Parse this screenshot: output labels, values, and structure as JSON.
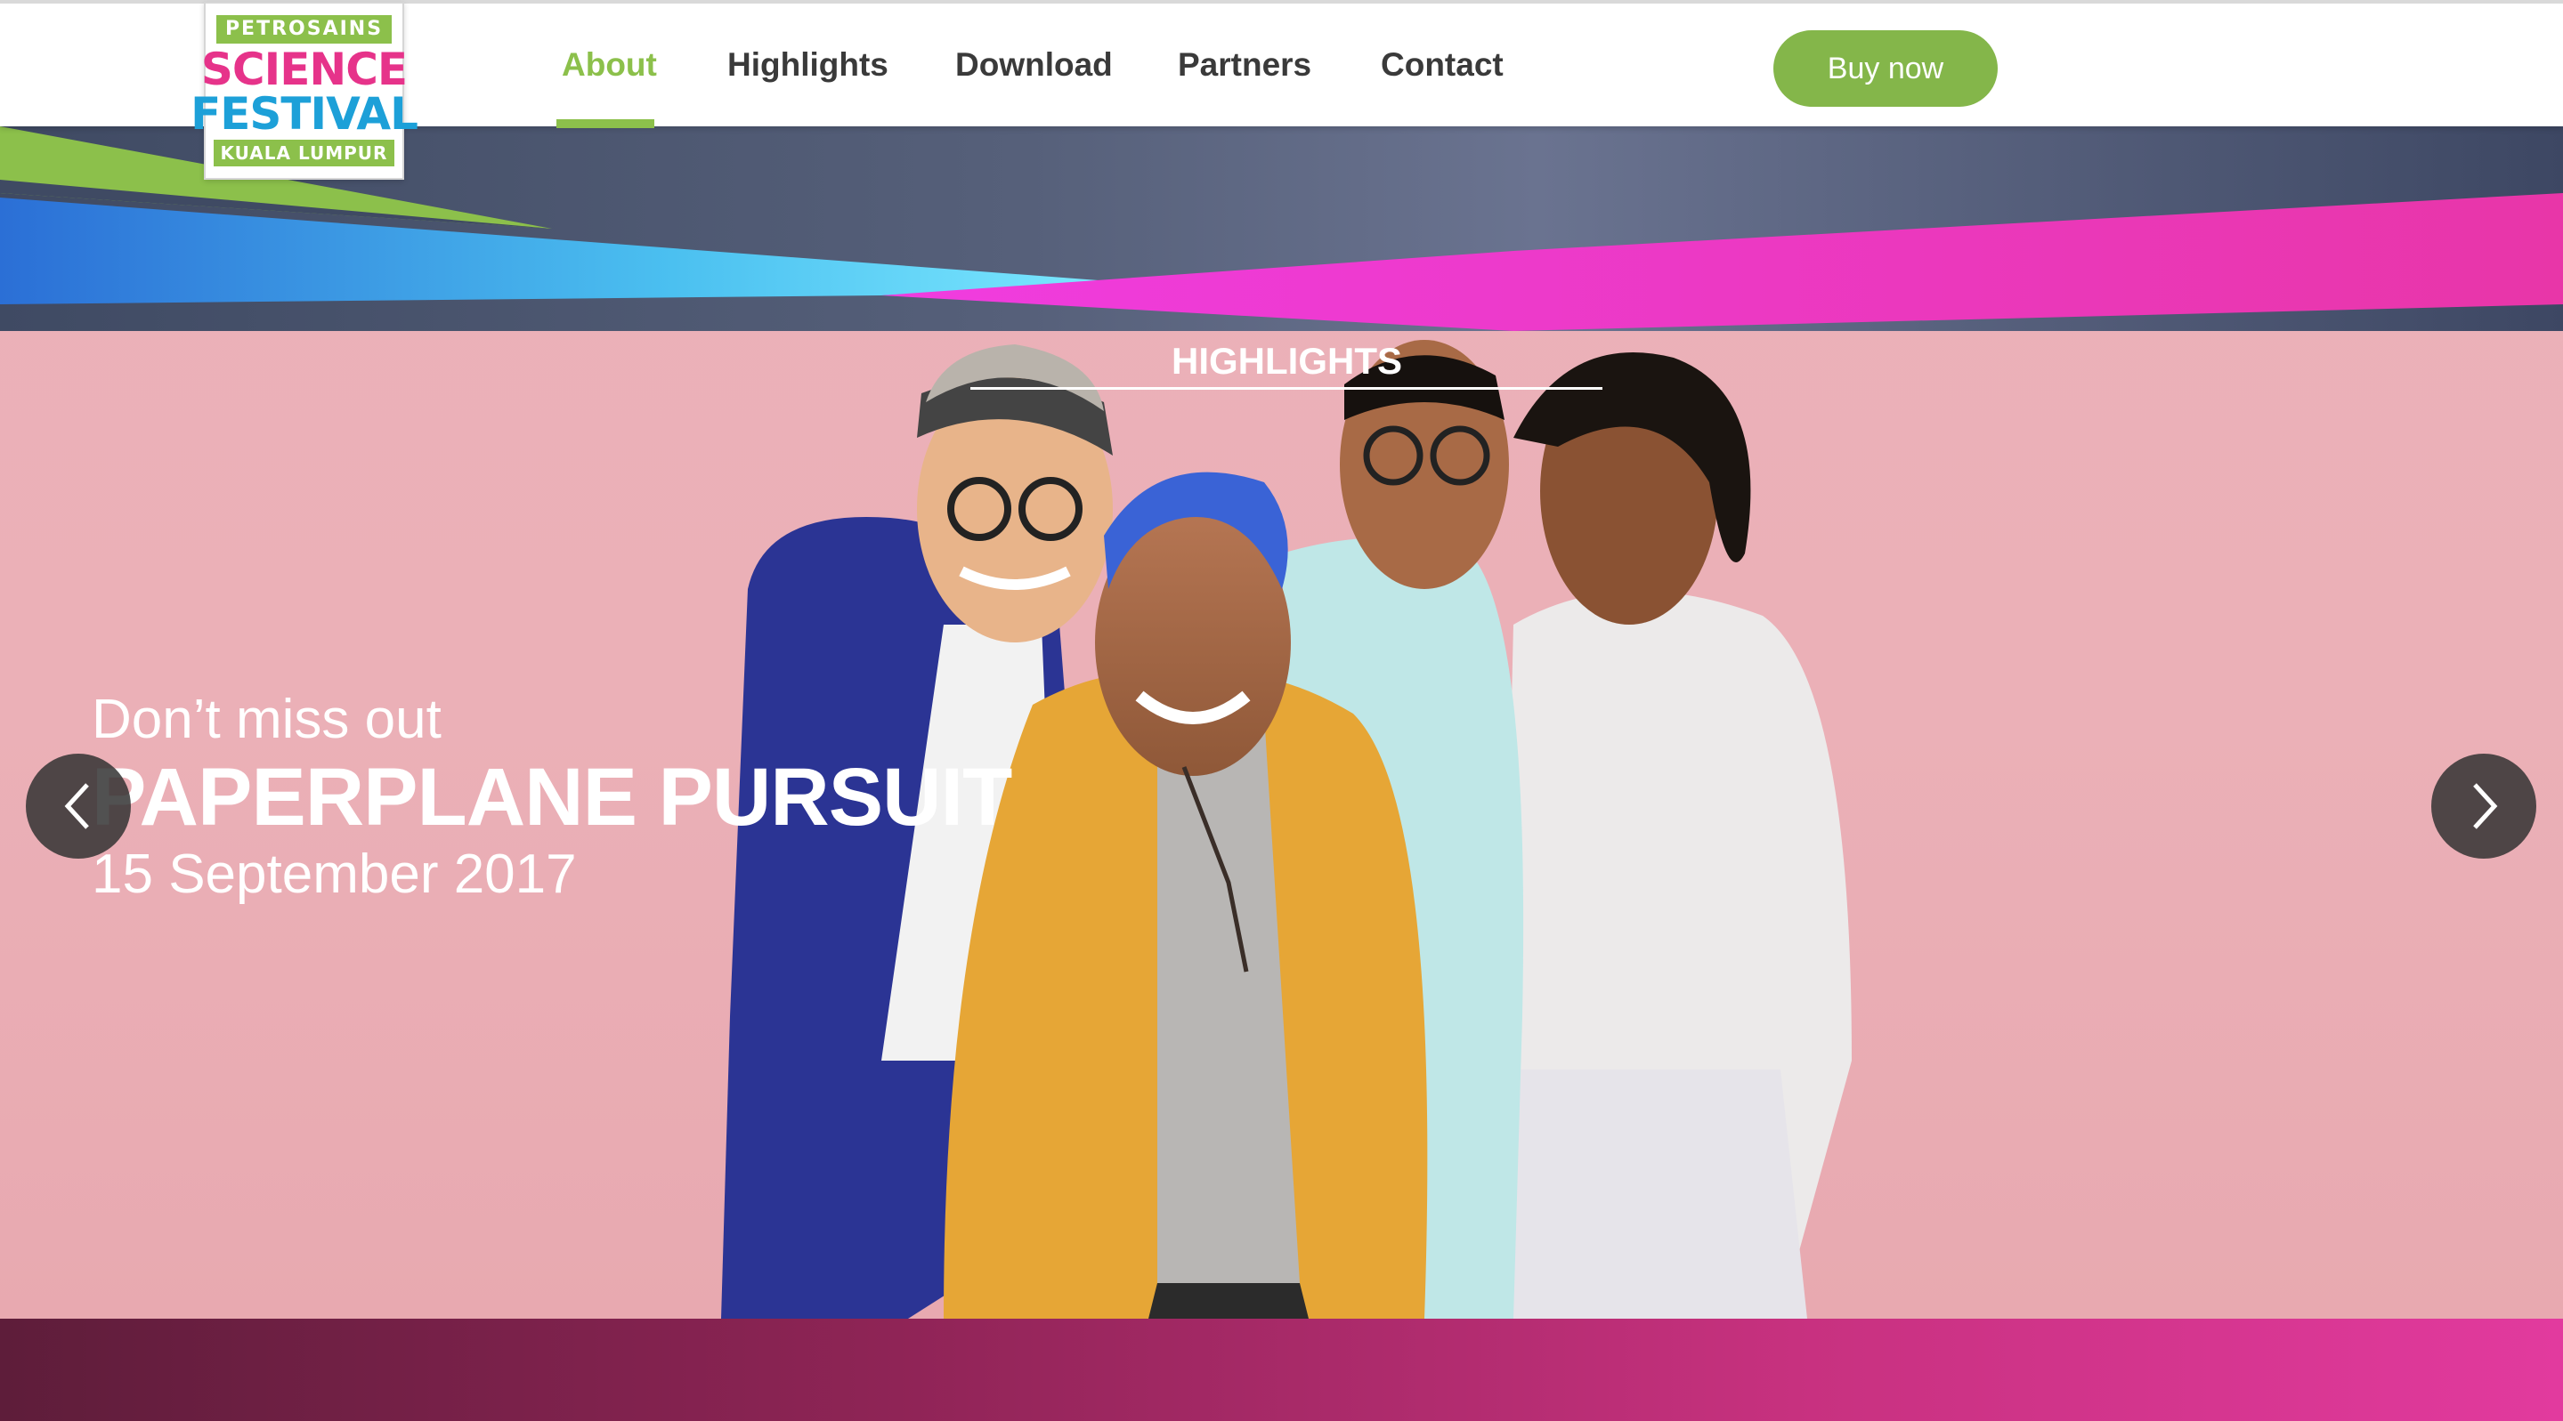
{
  "logo": {
    "top": "PETROSAINS",
    "line1": "SCIENCE",
    "line2": "FESTIVAL",
    "city": "KUALA LUMPUR"
  },
  "nav": {
    "items": [
      {
        "label": "About",
        "active": true
      },
      {
        "label": "Highlights",
        "active": false
      },
      {
        "label": "Download",
        "active": false
      },
      {
        "label": "Partners",
        "active": false
      },
      {
        "label": "Contact",
        "active": false
      }
    ],
    "cta": "Buy now"
  },
  "hero": {
    "section_label": "HIGHLIGHTS",
    "pre_title": "Don’t miss out",
    "title": "PAPERPLANE PURSUIT",
    "date": "15 September 2017"
  },
  "colors": {
    "brand_green": "#8cc04b",
    "brand_pink": "#e6338a",
    "brand_blue": "#1da0d8",
    "hero_bg": "#ebb1b8"
  },
  "icons": {
    "prev": "chevron-left-icon",
    "next": "chevron-right-icon"
  }
}
